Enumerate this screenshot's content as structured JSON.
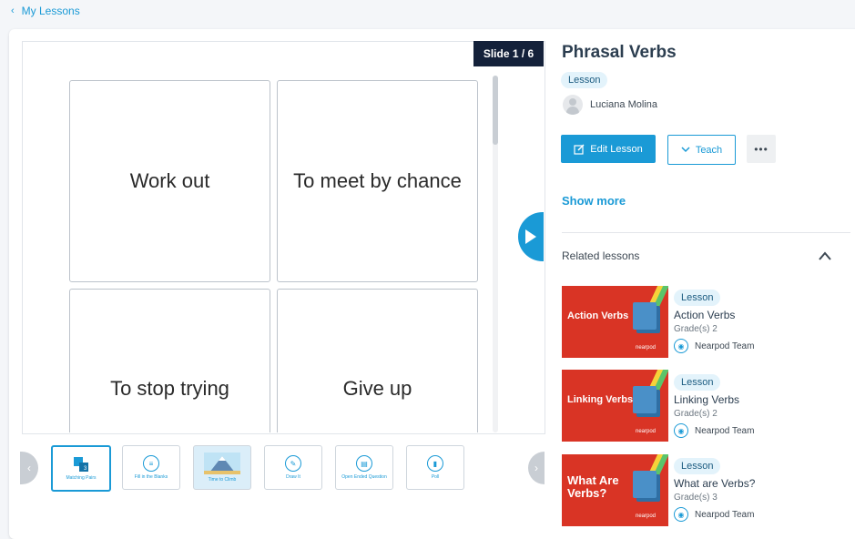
{
  "nav": {
    "back_label": "My Lessons"
  },
  "slide": {
    "badge": "Slide 1 / 6",
    "tiles": [
      "Work out",
      "To meet by chance",
      "To stop trying",
      "Give up"
    ]
  },
  "thumbnails": [
    {
      "caption": "Matching Pairs",
      "icon": "matching-icon"
    },
    {
      "caption": "Fill in the Blanks",
      "icon": "fill-blanks-icon"
    },
    {
      "caption": "Time to Climb",
      "icon": "mountain-icon"
    },
    {
      "caption": "Draw It",
      "icon": "pencil-icon"
    },
    {
      "caption": "Open Ended Question",
      "icon": "document-icon"
    },
    {
      "caption": "Poll",
      "icon": "bar-chart-icon"
    }
  ],
  "lesson": {
    "title": "Phrasal Verbs",
    "type_badge": "Lesson",
    "author": "Luciana Molina",
    "edit_label": "Edit Lesson",
    "teach_label": "Teach",
    "more_label": "•••",
    "show_more": "Show more"
  },
  "related": {
    "heading": "Related lessons",
    "items": [
      {
        "thumb_text": "Action Verbs",
        "badge": "Lesson",
        "title": "Action Verbs",
        "grade": "Grade(s) 2",
        "team": "Nearpod Team"
      },
      {
        "thumb_text": "Linking Verbs",
        "badge": "Lesson",
        "title": "Linking Verbs",
        "grade": "Grade(s) 2",
        "team": "Nearpod Team"
      },
      {
        "thumb_text": "What Are Verbs?",
        "badge": "Lesson",
        "title": "What are Verbs?",
        "grade": "Grade(s) 3",
        "team": "Nearpod Team"
      }
    ],
    "brand": "nearpod"
  },
  "colors": {
    "accent": "#1a9ad6",
    "badge_bg": "#14213a",
    "thumb_red": "#d93425"
  }
}
